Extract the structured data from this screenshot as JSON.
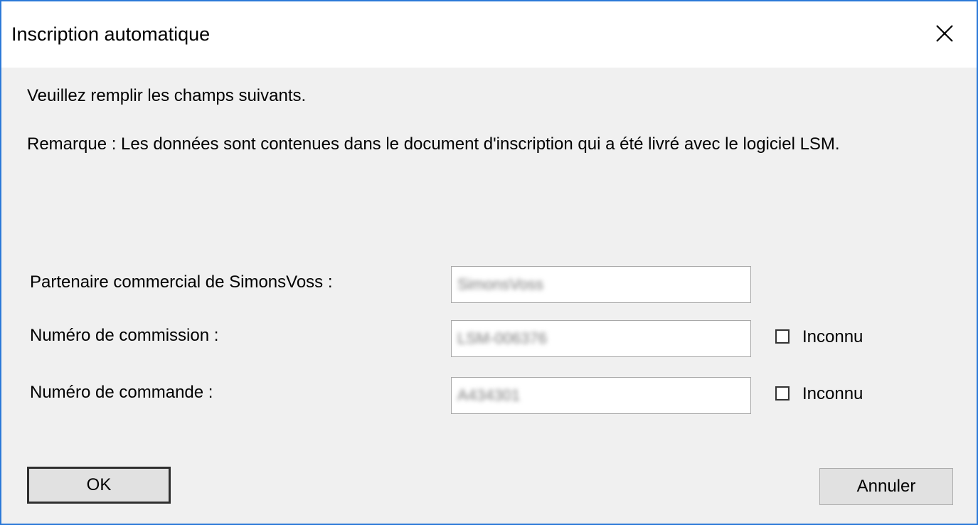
{
  "window": {
    "title": "Inscription automatique",
    "close_icon": "close-icon"
  },
  "content": {
    "instruction": "Veuillez remplir les champs suivants.",
    "notice": "Remarque : Les données sont contenues dans le document d'inscription qui a été livré avec le logiciel LSM."
  },
  "form": {
    "partner_label": "Partenaire commercial de SimonsVoss :",
    "partner_value": "SimonsVoss",
    "commission_label": "Numéro de commission :",
    "commission_value": "LSM-006376",
    "commission_unknown_label": "Inconnu",
    "commission_unknown_checked": false,
    "order_label": "Numéro de commande :",
    "order_value": "A434301",
    "order_unknown_label": "Inconnu",
    "order_unknown_checked": false
  },
  "buttons": {
    "ok_label": "OK",
    "cancel_label": "Annuler"
  },
  "colors": {
    "window_border": "#2b79d8",
    "dialog_background": "#f0f0f0",
    "titlebar_background": "#ffffff"
  }
}
